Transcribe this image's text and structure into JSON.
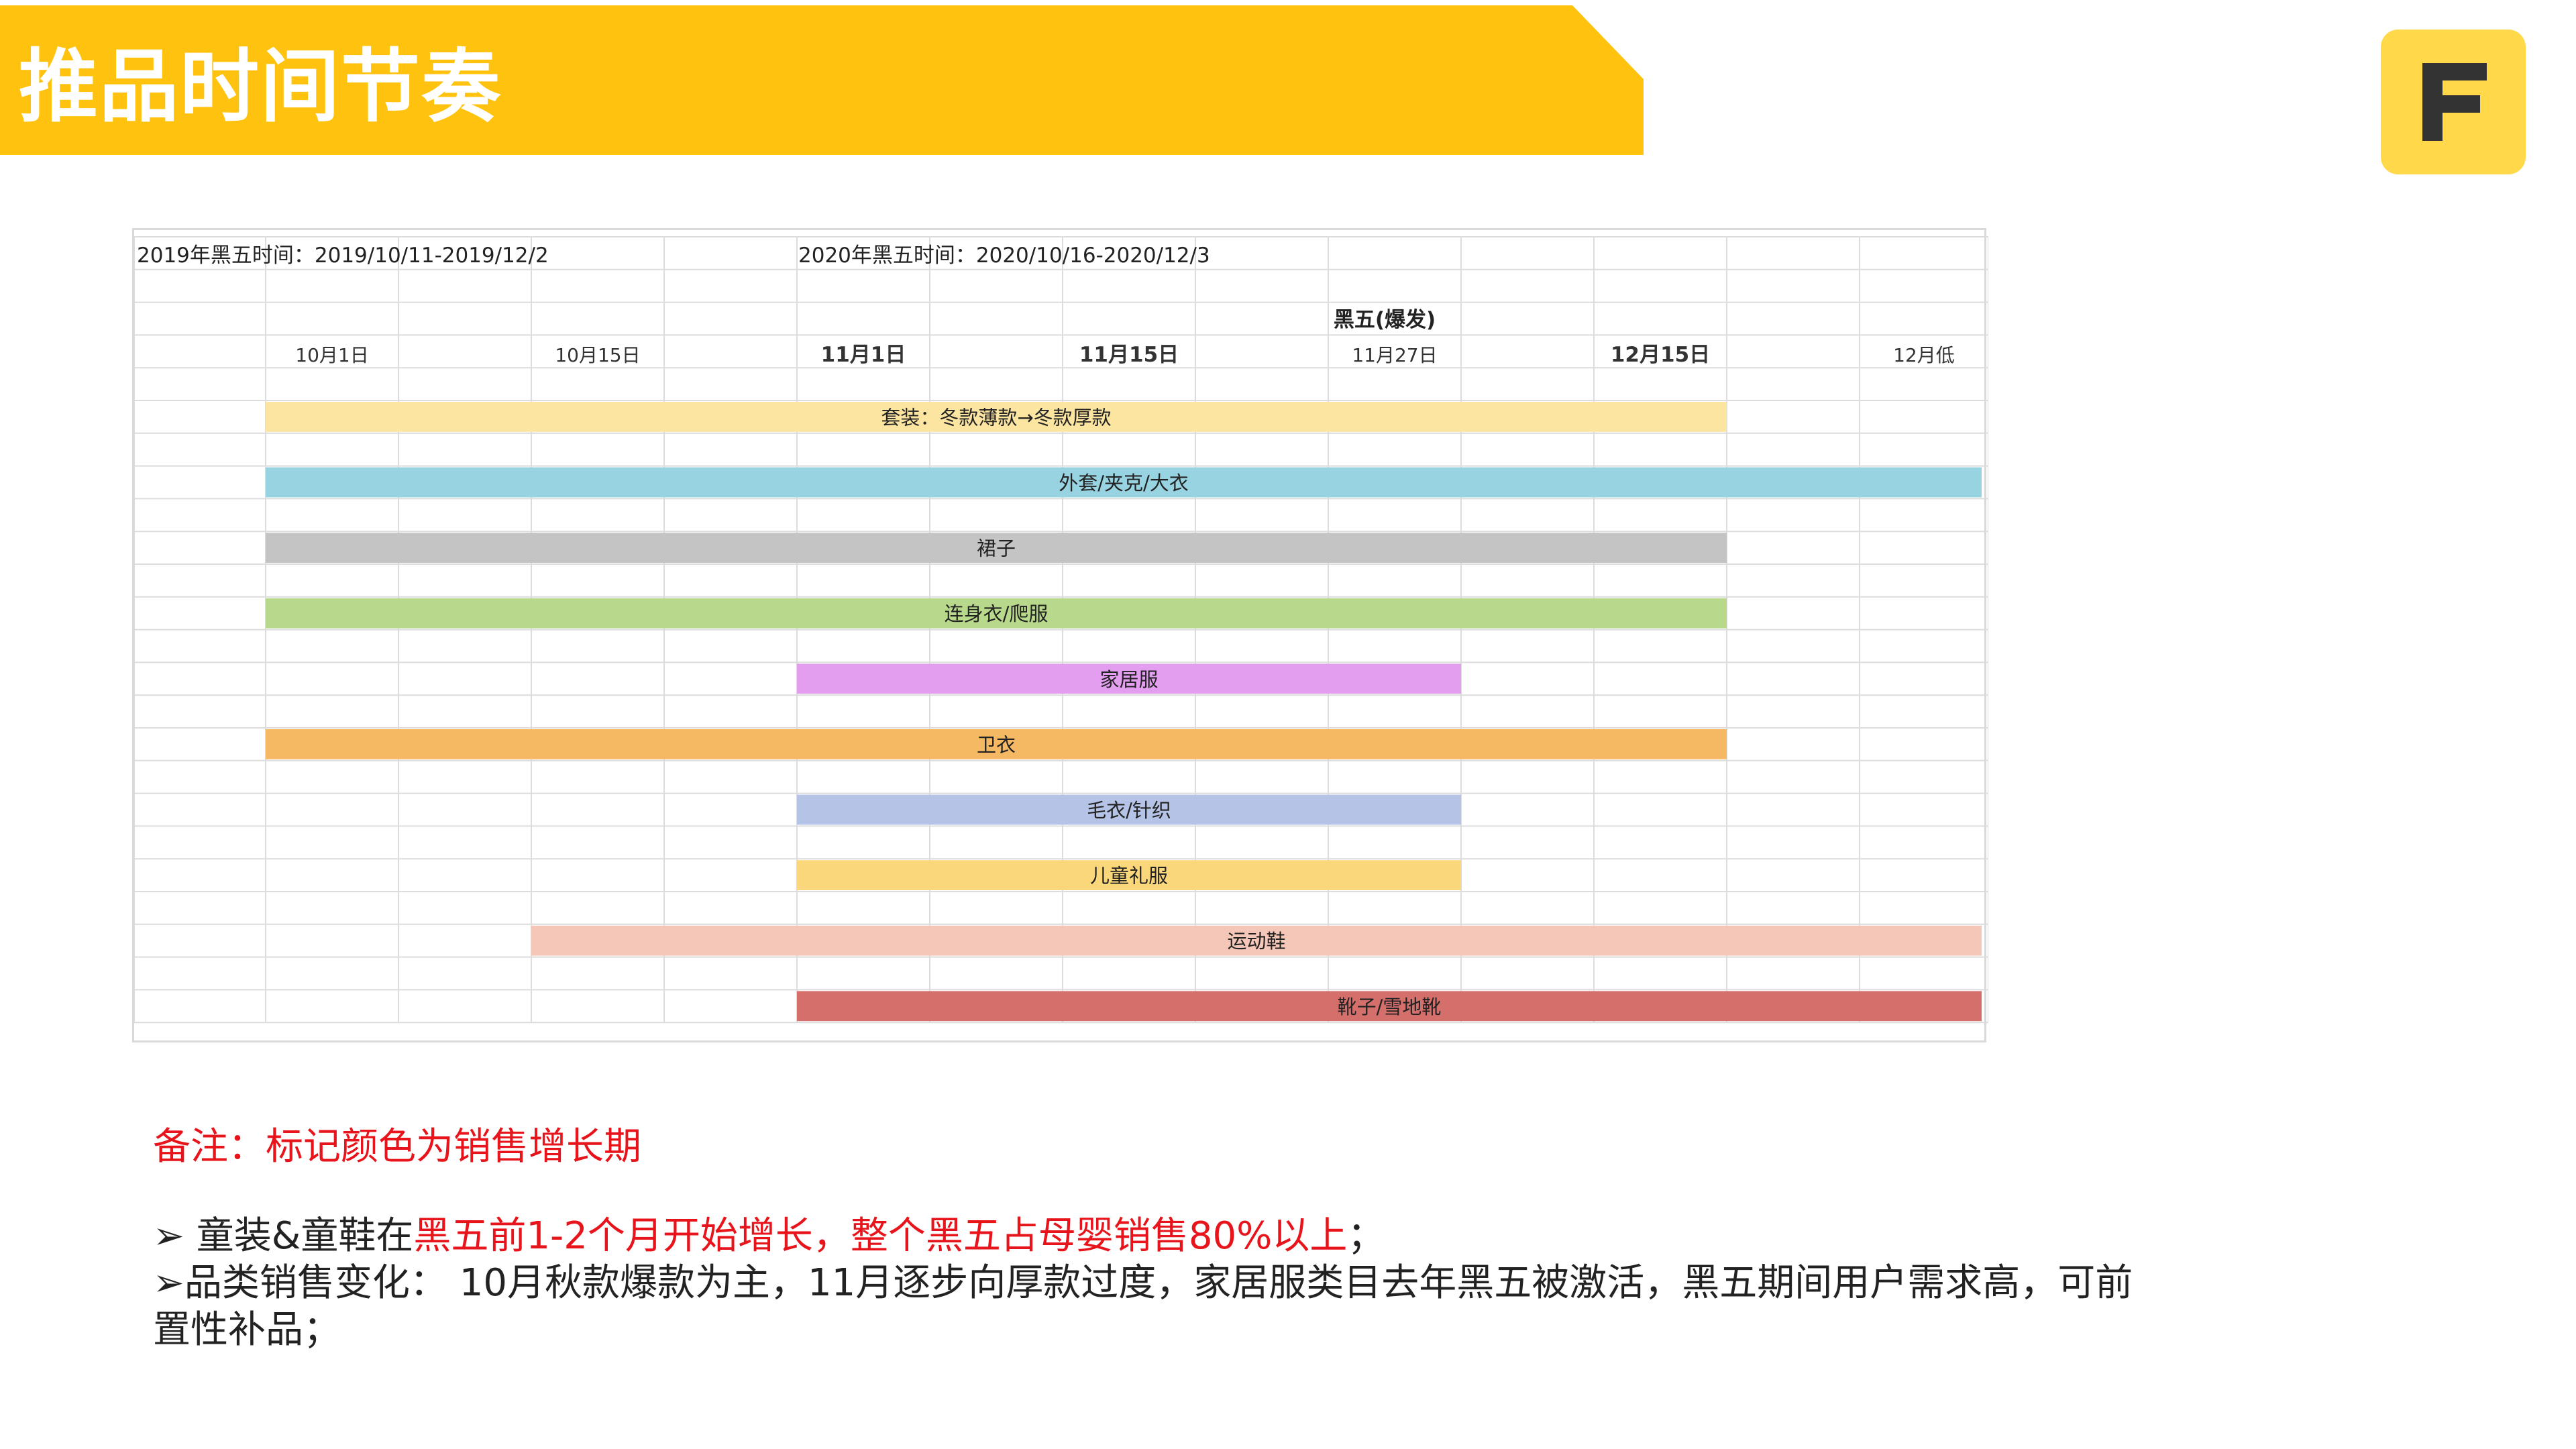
{
  "page": {
    "title": "推品时间节奏",
    "logo_letter": "F",
    "colors": {
      "banner": "#ffc20e",
      "logo_bg": "#ffd94a",
      "logo_fg": "#333333",
      "highlight_red": "#e8141b"
    }
  },
  "timeline": {
    "header_2019": "2019年黑五时间：2019/10/11-2019/12/2",
    "header_2020": "2020年黑五时间：2020/10/16-2020/12/3",
    "blackfriday_label": "黑五(爆发)",
    "dates": [
      "10月1日",
      "10月15日",
      "11月1日",
      "11月15日",
      "11月27日",
      "12月15日",
      "12月低"
    ],
    "bars": [
      {
        "label": "套装：冬款薄款→冬款厚款",
        "start": "10月1日",
        "end": "12月15日+",
        "color": "#fce5a1"
      },
      {
        "label": "外套/夹克/大衣",
        "start": "10月1日",
        "end": "12月低+",
        "color": "#98d3e2"
      },
      {
        "label": "裙子",
        "start": "10月1日",
        "end": "12月15日+",
        "color": "#c4c4c4"
      },
      {
        "label": "连身衣/爬服",
        "start": "10月1日",
        "end": "12月15日+",
        "color": "#b8d98c"
      },
      {
        "label": "家居服",
        "start": "11月1日",
        "end": "11月27日+",
        "color": "#e39ef0"
      },
      {
        "label": "卫衣",
        "start": "10月1日",
        "end": "12月15日+",
        "color": "#f5b863"
      },
      {
        "label": "毛衣/针织",
        "start": "11月1日",
        "end": "11月27日+",
        "color": "#b5c4e6"
      },
      {
        "label": "儿童礼服",
        "start": "11月1日",
        "end": "11月27日+",
        "color": "#fbd77c"
      },
      {
        "label": "运动鞋",
        "start": "10月15日",
        "end": "12月低+",
        "color": "#f5c7b8"
      },
      {
        "label": "靴子/雪地靴",
        "start": "11月1日",
        "end": "12月低+",
        "color": "#d46f6c"
      }
    ]
  },
  "notes": {
    "remark": "备注：标记颜色为销售增长期",
    "bullet1_prefix": "➢ 童装&童鞋在",
    "bullet1_highlight": "黑五前1-2个月开始增长，整个黑五占母婴销售80%以上",
    "bullet1_suffix": "；",
    "bullet2": "➢品类销售变化： 10月秋款爆款为主，11月逐步向厚款过度，家居服类目去年黑五被激活，黑五期间用户需求高，可前置性补品；"
  }
}
